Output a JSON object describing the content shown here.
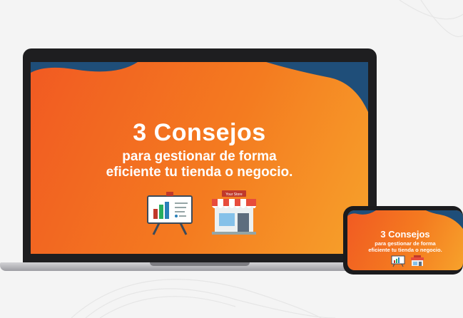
{
  "slide": {
    "title": "3 Consejos",
    "subtitle_line1": "para gestionar de forma",
    "subtitle_line2": "eficiente tu tienda o negocio."
  },
  "icons": {
    "chart_board": "presentation-chart-icon",
    "store": "store-front-icon",
    "store_sign": "Your Store"
  },
  "phone_slide": {
    "title": "3 Consejos",
    "subtitle_line1": "para gestionar de forma",
    "subtitle_line2": "eficiente tu tienda o negocio."
  },
  "colors": {
    "orange_start": "#f15a22",
    "orange_end": "#f7a22b",
    "navy": "#1f4e79",
    "device_frame": "#1e1e20"
  }
}
